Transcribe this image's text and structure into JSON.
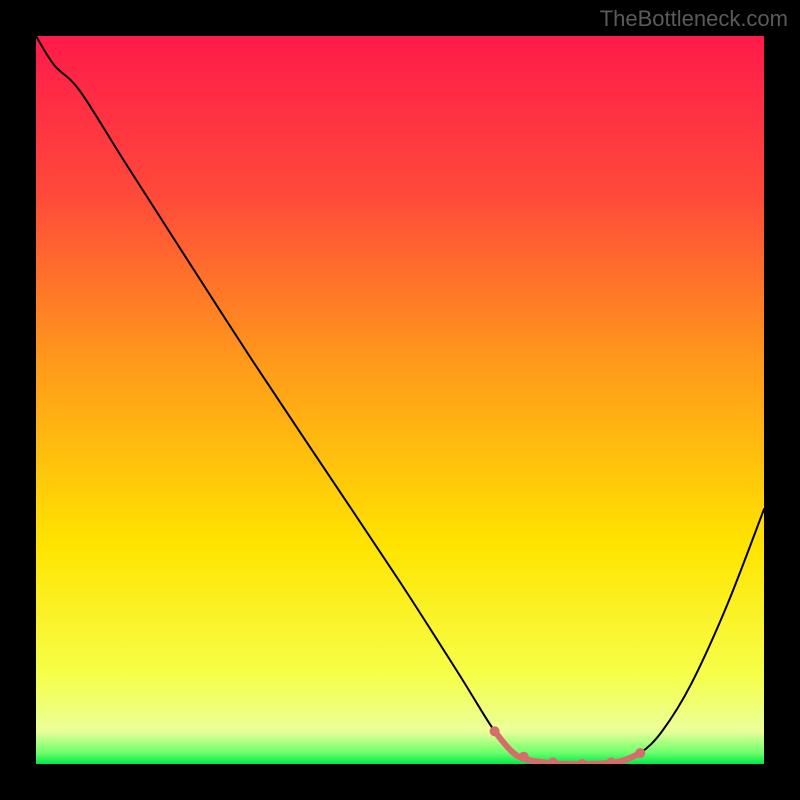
{
  "watermark": "TheBottleneck.com",
  "chart_data": {
    "type": "line",
    "title": "",
    "xlabel": "",
    "ylabel": "",
    "xlim": [
      0,
      100
    ],
    "ylim": [
      0,
      100
    ],
    "grid": false,
    "legend": false,
    "gradient_stops": [
      {
        "offset": 0.0,
        "color": "#ff1a4a"
      },
      {
        "offset": 0.22,
        "color": "#ff4a3a"
      },
      {
        "offset": 0.45,
        "color": "#ff9a1a"
      },
      {
        "offset": 0.7,
        "color": "#ffe400"
      },
      {
        "offset": 0.88,
        "color": "#f6ff4a"
      },
      {
        "offset": 0.955,
        "color": "#eaff9a"
      },
      {
        "offset": 0.985,
        "color": "#6aff6a"
      },
      {
        "offset": 1.0,
        "color": "#00e84a"
      }
    ],
    "series": [
      {
        "name": "curve",
        "color": "#000000",
        "width": 2.0,
        "x": [
          0.0,
          2.5,
          6.0,
          12.0,
          20.0,
          30.0,
          40.0,
          50.0,
          58.0,
          63.0,
          66.0,
          70.0,
          75.0,
          80.0,
          83.0,
          86.0,
          90.0,
          95.0,
          100.0
        ],
        "y": [
          100.0,
          96.0,
          92.5,
          83.0,
          70.5,
          55.0,
          40.0,
          25.0,
          12.5,
          4.5,
          1.2,
          0.2,
          0.0,
          0.3,
          1.5,
          4.5,
          11.0,
          22.0,
          35.0
        ]
      },
      {
        "name": "bottom-highlight",
        "color": "#d86b6b",
        "width": 6.0,
        "x": [
          63.0,
          66.0,
          70.0,
          75.0,
          80.0,
          83.0
        ],
        "y": [
          4.5,
          1.2,
          0.2,
          0.0,
          0.3,
          1.5
        ]
      }
    ],
    "highlight_dots": {
      "color": "#d86b6b",
      "radius": 5.0,
      "points": [
        {
          "x": 63.0,
          "y": 4.5
        },
        {
          "x": 67.0,
          "y": 1.0
        },
        {
          "x": 71.0,
          "y": 0.2
        },
        {
          "x": 75.0,
          "y": 0.0
        },
        {
          "x": 79.0,
          "y": 0.2
        },
        {
          "x": 83.0,
          "y": 1.5
        }
      ]
    }
  }
}
